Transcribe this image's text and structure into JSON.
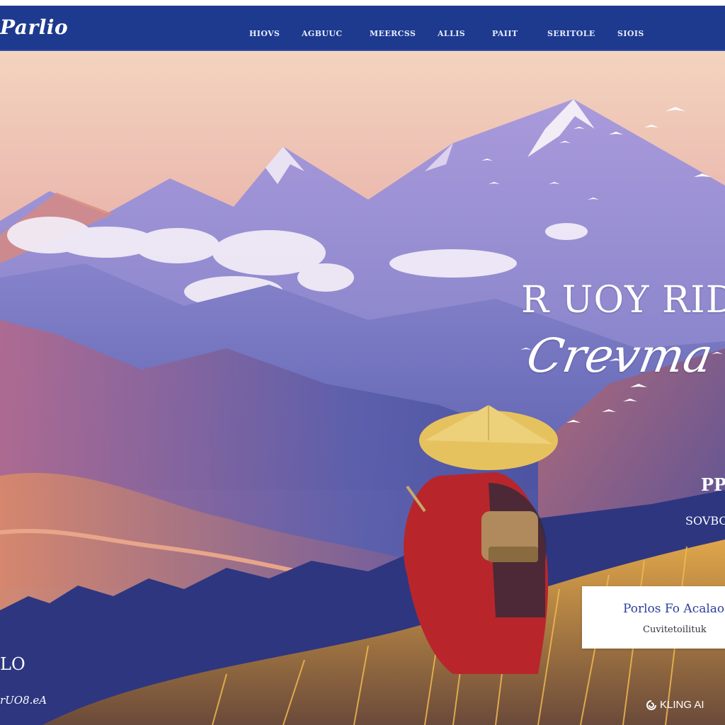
{
  "header": {
    "logo": "Parlio",
    "nav": [
      "HIOVS",
      "AGBUUC",
      "MEERCSS",
      "ALLIS",
      "PAIIT",
      "SERITOLE",
      "SIOIS"
    ],
    "bar_color": "#1d3a8f"
  },
  "hero": {
    "headline": "R UOY RID",
    "script": "Crevma",
    "side_label": "PPE",
    "side_small": "SOVBO",
    "card_title": "Porlos Fo Acalao",
    "card_subtitle": "Cuvitetoilituk",
    "corner_big": "LO",
    "corner_small": "rUO8.eA",
    "sky_colors": [
      "#f2c9b0",
      "#c9a7d8",
      "#7a78c6"
    ],
    "hat_color": "#e6c25f",
    "robe_color": "#b8262b"
  },
  "watermark": {
    "icon": "kling-logo-icon",
    "text": "KLING AI"
  }
}
